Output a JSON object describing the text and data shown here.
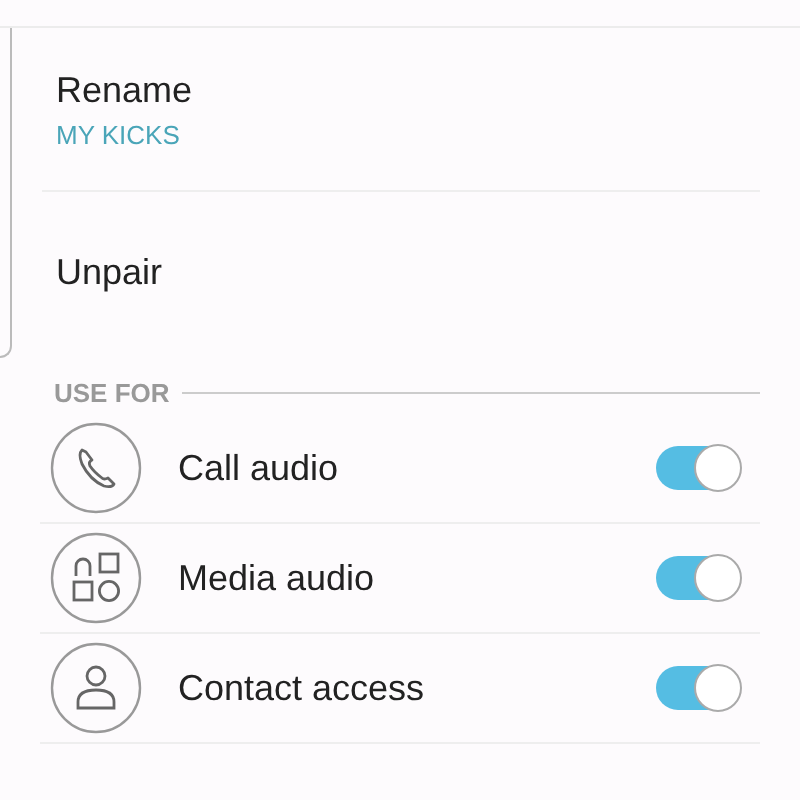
{
  "actions": [
    {
      "kind": "rename",
      "label": "Rename",
      "value": "MY KICKS"
    },
    {
      "kind": "plain",
      "label": "Unpair"
    }
  ],
  "section": {
    "title": "USE FOR"
  },
  "features": [
    {
      "kind": "phone",
      "label": "Call audio",
      "on": true
    },
    {
      "kind": "media",
      "label": "Media audio",
      "on": true
    },
    {
      "kind": "person",
      "label": "Contact access",
      "on": true
    }
  ]
}
